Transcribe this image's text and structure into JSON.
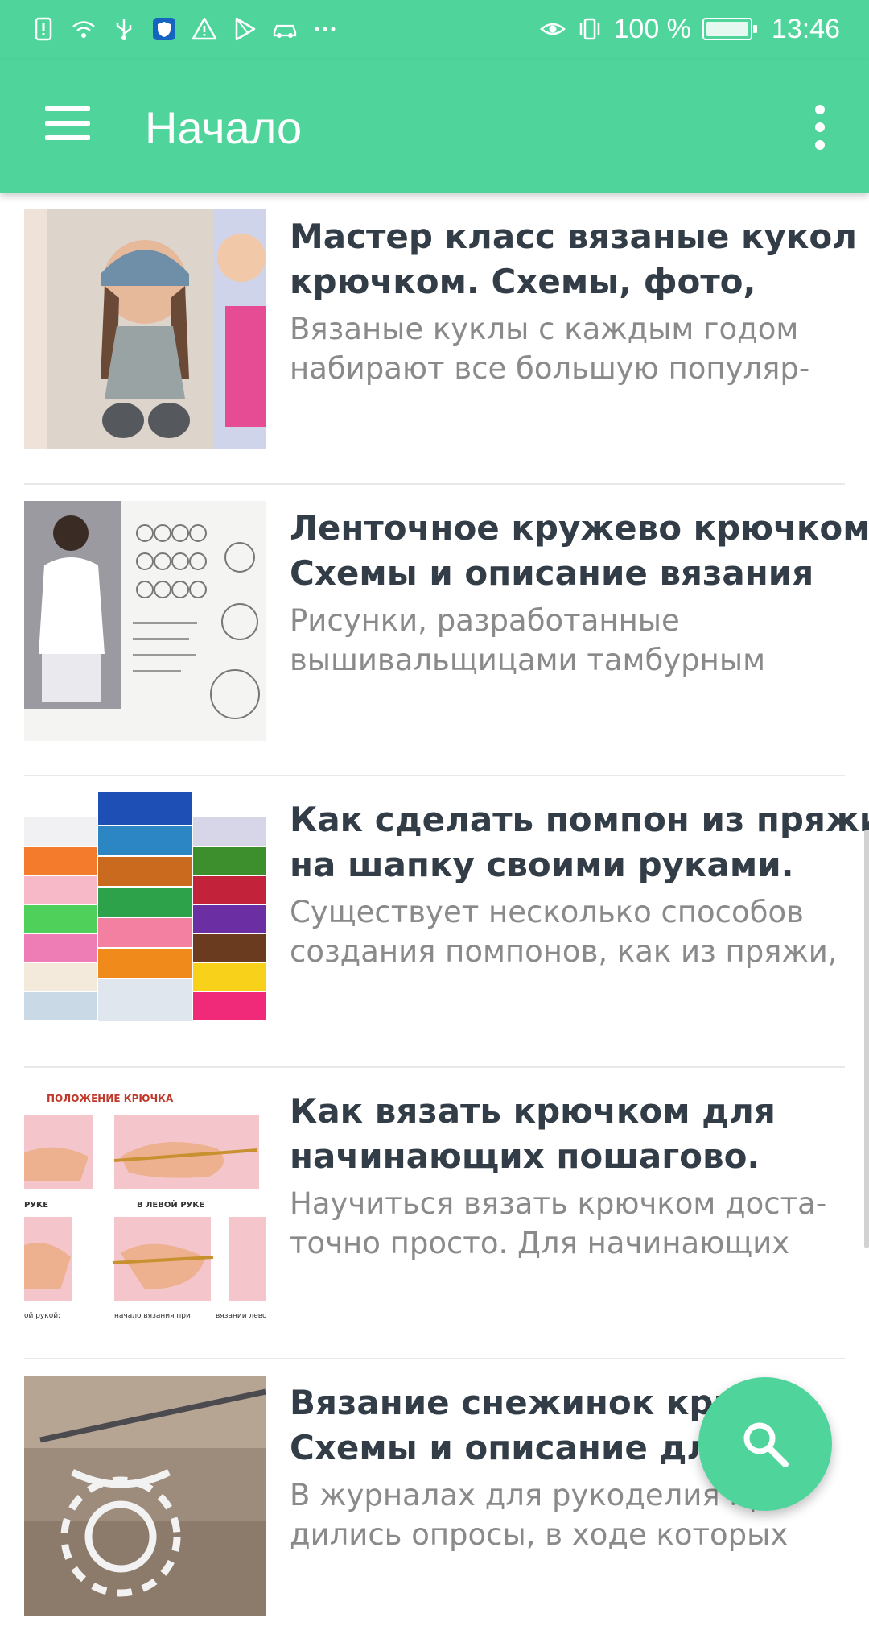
{
  "status_bar": {
    "battery_text": "100 %",
    "time": "13:46",
    "icons": [
      "alert-icon",
      "wifi-icon",
      "usb-icon",
      "shield-icon",
      "warning-icon",
      "play-store-icon",
      "car-icon",
      "more-notifications-icon",
      "eye-icon",
      "vibrate-icon",
      "battery-icon"
    ]
  },
  "app_bar": {
    "title": "Начало",
    "menu_icon": "menu-icon",
    "overflow_icon": "more-vert-icon"
  },
  "articles": [
    {
      "title_lines": [
        "Мастер класс вязаные кукол",
        "крючком. Схемы, фото,"
      ],
      "desc_lines": [
        "Вязаные куклы с каждым годом",
        "набирают все большую популяр-"
      ],
      "thumb": "crochet-doll-image"
    },
    {
      "title_lines": [
        "Ленточное кружево крючком.",
        "Схемы и описание вязания"
      ],
      "desc_lines": [
        "Рисунки, разработанные",
        "вышивальщицами тамбурным"
      ],
      "thumb": "lace-pattern-image"
    },
    {
      "title_lines": [
        "Как сделать помпон из пряжи",
        "на шапку своими руками."
      ],
      "desc_lines": [
        "Существует несколько способов",
        "создания помпонов, как из пряжи,"
      ],
      "thumb": "ribbon-spools-image"
    },
    {
      "title_lines": [
        "Как вязать крючком для",
        "начинающих пошагово."
      ],
      "desc_lines": [
        "Научиться вязать крючком доста-",
        "точно просто. Для начинающих"
      ],
      "thumb": "crochet-hook-hands-image",
      "thumb_labels": [
        "ПОЛОЖЕНИЕ КРЮЧКА",
        "РУКЕ",
        "В ЛЕВОЙ РУКЕ",
        "ой рукой;",
        "начало вязания при",
        "вязании левой"
      ]
    },
    {
      "title_lines": [
        "Вязание снежинок крю",
        "Схемы и описание для"
      ],
      "desc_lines": [
        "В журналах для рукоделия про-",
        "дились опросы, в ходе которых"
      ],
      "thumb": "snowflake-crochet-image"
    }
  ],
  "fab": {
    "icon": "search-icon"
  },
  "colors": {
    "accent": "#4fd59c",
    "title_text": "#333d47",
    "desc_text": "#8a8a8a",
    "divider": "#e9e9e9"
  }
}
